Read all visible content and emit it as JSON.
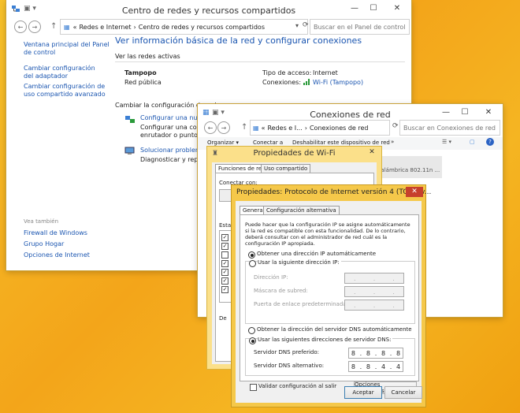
{
  "main_window": {
    "title": "Centro de redes y recursos compartidos",
    "address_parts": [
      "«",
      "Redes e Internet",
      "›",
      "Centro de redes y recursos compartidos"
    ],
    "search_placeholder": "Buscar en el Panel de control",
    "sidebar_links": [
      "Ventana principal del Panel de control",
      "Cambiar configuración del adaptador",
      "Cambiar configuración de uso compartido avanzado"
    ],
    "see_also_label": "Vea también",
    "see_also_links": [
      "Firewall de Windows",
      "Grupo Hogar",
      "Opciones de Internet"
    ],
    "heading": "Ver información básica de la red y configurar conexiones",
    "active_networks_label": "Ver las redes activas",
    "network_name": "Tampopo",
    "network_type": "Red pública",
    "access_type_label": "Tipo de acceso:",
    "access_type_value": "Internet",
    "connections_label": "Conexiones:",
    "connections_value": "Wi-Fi (Tampopo)",
    "change_settings_label": "Cambiar la configuración de red",
    "setup_link": "Configurar una nueva",
    "setup_desc": "Configurar una conexi",
    "setup_desc2": "enrutador o punto de",
    "troubleshoot_link": "Solucionar problemas",
    "troubleshoot_desc": "Diagnosticar y reparar"
  },
  "conn_window": {
    "title": "Conexiones de red",
    "address_parts": [
      "«",
      "Redes e I...",
      "›",
      "Conexiones de red"
    ],
    "search_placeholder": "Buscar en Conexiones de red",
    "toolbar_items": [
      "Organizar ▾",
      "Conectar a",
      "Deshabilitar este dispositivo de red",
      "»"
    ],
    "adapter_text": "nalámbrica 802.11n ..."
  },
  "wifi_props": {
    "title": "Propiedades de Wi-Fi",
    "tabs": [
      "Funciones de red",
      "Uso compartido"
    ],
    "connect_using_label": "Conectar con:",
    "items_label_fragment": "Esta",
    "desc_label_fragment": "De"
  },
  "ipv4_dialog": {
    "title": "Propiedades: Protocolo de Internet versión 4 (TCP/IPv...",
    "tabs": [
      "General",
      "Configuración alternativa"
    ],
    "description": "Puede hacer que la configuración IP se asigne automáticamente si la red es compatible con esta funcionalidad. De lo contrario, deberá consultar con el administrador de red cuál es la configuración IP apropiada.",
    "auto_ip_label": "Obtener una dirección IP automáticamente",
    "manual_ip_label": "Usar la siguiente dirección IP:",
    "ip_address_label": "Dirección IP:",
    "subnet_label": "Máscara de subred:",
    "gateway_label": "Puerta de enlace predeterminada:",
    "auto_dns_label": "Obtener la dirección del servidor DNS automáticamente",
    "manual_dns_label": "Usar las siguientes direcciones de servidor DNS:",
    "preferred_dns_label": "Servidor DNS preferido:",
    "alternate_dns_label": "Servidor DNS alternativo:",
    "preferred_dns": [
      "8",
      "8",
      "8",
      "8"
    ],
    "alternate_dns": [
      "8",
      "8",
      "4",
      "4"
    ],
    "validate_label": "Validar configuración al salir",
    "advanced_button": "Opciones avanzadas...",
    "ok_button": "Aceptar",
    "cancel_button": "Cancelar"
  },
  "colors": {
    "accent_link": "#1a55b0",
    "close_red": "#c7402c",
    "desktop_orange": "#f3a51a",
    "dialog_frame_yellow": "#f5c84a"
  }
}
